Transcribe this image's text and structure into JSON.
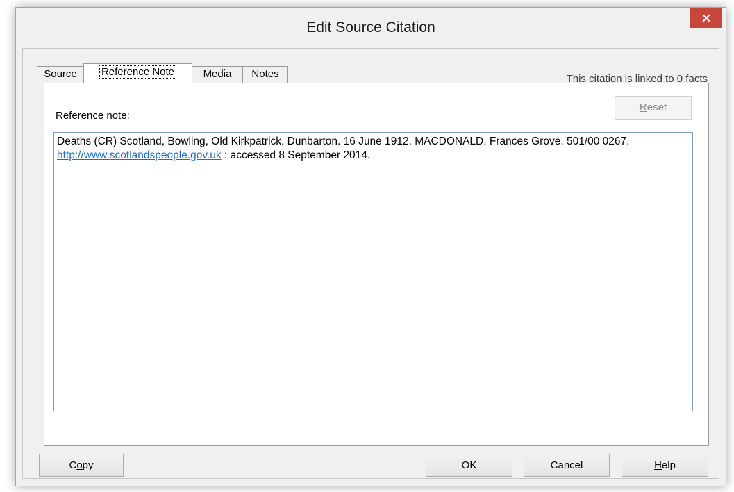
{
  "window": {
    "title": "Edit Source Citation",
    "close_label": "×"
  },
  "tabs": [
    {
      "label": "Source",
      "active": false
    },
    {
      "label": "Reference Note",
      "active": true
    },
    {
      "label": "Media",
      "active": false
    },
    {
      "label": "Notes",
      "active": false
    }
  ],
  "linked_facts_text": "This citation is linked to 0 facts",
  "reference_note": {
    "label_prefix": "Reference ",
    "label_mnemonic": "n",
    "label_suffix": "ote:",
    "reset_mnemonic": "R",
    "reset_rest": "eset",
    "text_before_link": "Deaths (CR) Scotland, Bowling, Old Kirkpatrick, Dunbarton. 16 June 1912. MACDONALD, Frances Grove. 501/00 0267. ",
    "link_text": "http://www.scotlandspeople.gov.uk",
    "text_after_link": " : accessed 8 September 2014."
  },
  "buttons": {
    "copy_prefix": "C",
    "copy_mnemonic": "o",
    "copy_suffix": "py",
    "ok": "OK",
    "cancel": "Cancel",
    "help_mnemonic": "H",
    "help_rest": "elp"
  },
  "colors": {
    "close_button": "#c7473c",
    "link": "#1a6ccf",
    "textbox_border": "#7a9cc6"
  }
}
